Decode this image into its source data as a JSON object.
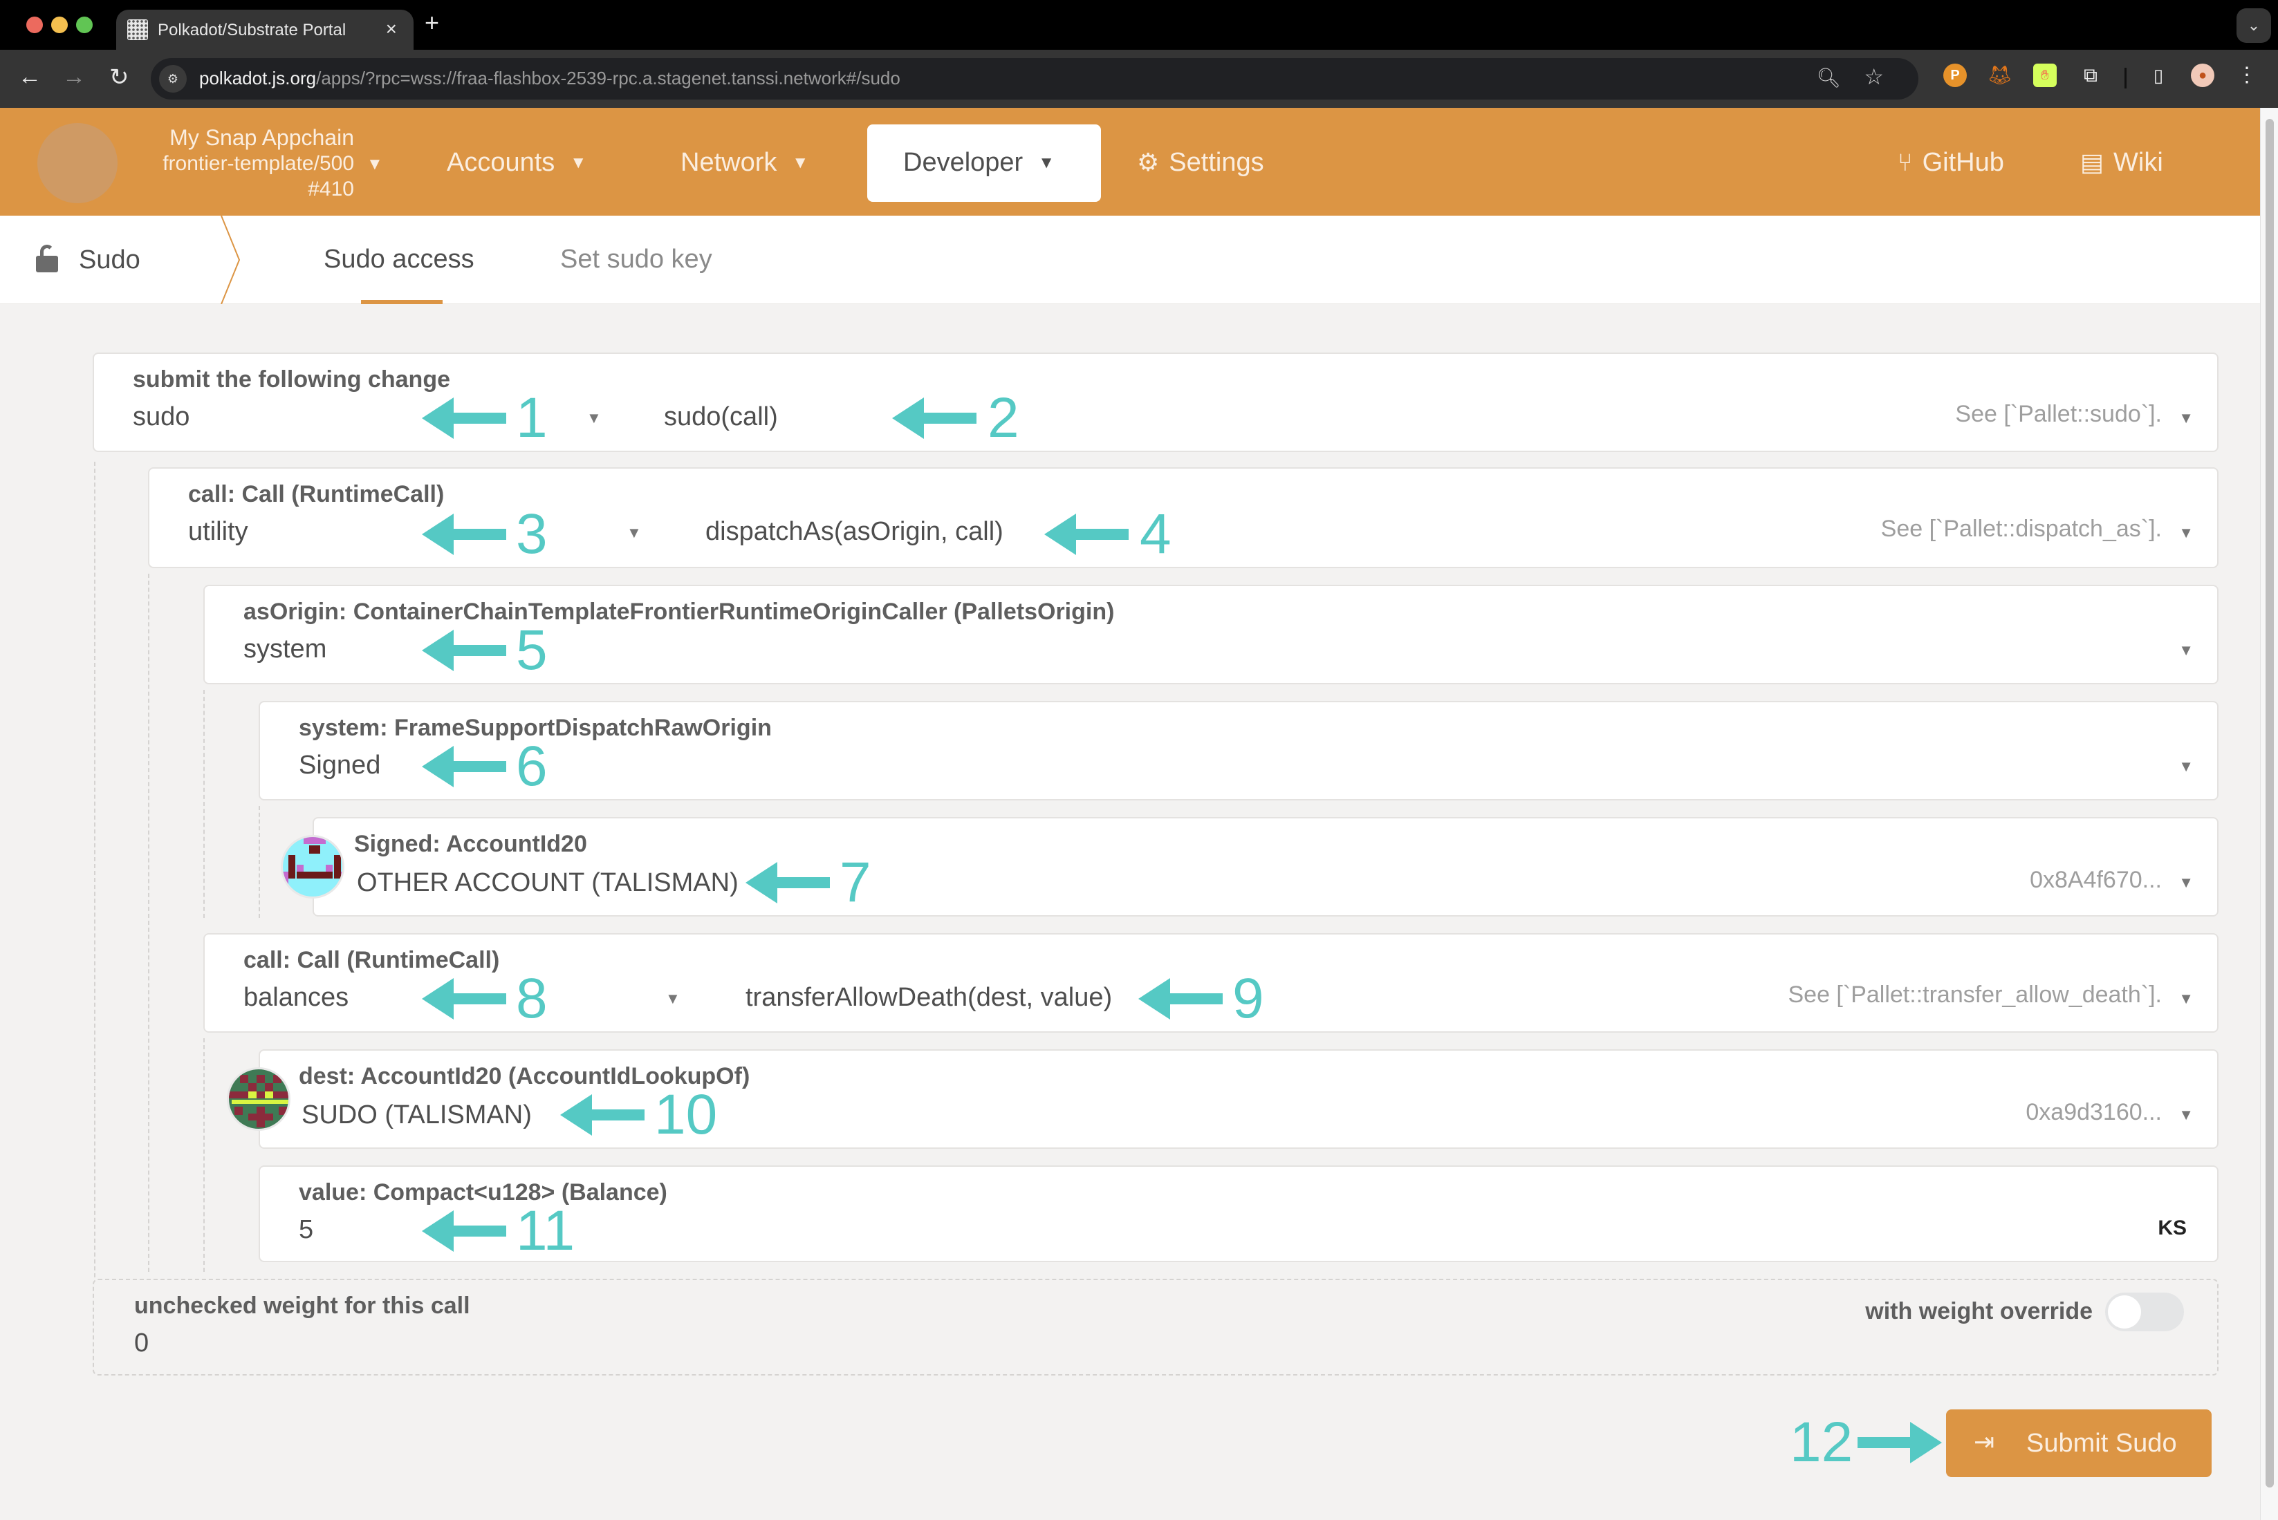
{
  "browser": {
    "tab_title": "Polkadot/Substrate Portal",
    "tab_close": "×",
    "new_tab": "+",
    "tab_dropdown": "⌄",
    "url_host": "polkadot.js.org",
    "url_path": "/apps/?rpc=wss://fraa-flashbox-2539-rpc.a.stagenet.tanssi.network#/sudo",
    "icons": {
      "back": "←",
      "forward": "→",
      "reload": "↻",
      "site_info": "⚙",
      "zoom": "🔍︎",
      "bookmark": "☆",
      "polkadot_ext": "P",
      "metamask_ext": "🦊︎",
      "talisman_ext": "✋︎",
      "extensions": "⧉",
      "side_panel": "▯",
      "profile": "●",
      "menu": "⋮"
    }
  },
  "header": {
    "chain_name": "My Snap Appchain",
    "chain_runtime": "frontier-template/500",
    "chain_block": "#410",
    "caret": "▼",
    "menu": {
      "accounts": "Accounts",
      "network": "Network",
      "developer": "Developer",
      "settings": "Settings",
      "github": "GitHub",
      "wiki": "Wiki"
    },
    "icons": {
      "settings": "⚙",
      "github": "⑂",
      "wiki": "▤"
    }
  },
  "subnav": {
    "section": "Sudo",
    "tabs": [
      {
        "label": "Sudo access",
        "active": true
      },
      {
        "label": "Set sudo key",
        "active": false
      }
    ]
  },
  "form": {
    "submit_change": {
      "label": "submit the following change",
      "pallet": "sudo",
      "method": "sudo(call)",
      "hint": "See [`Pallet::sudo`]."
    },
    "call1": {
      "label": "call: Call (RuntimeCall)",
      "pallet": "utility",
      "method": "dispatchAs(asOrigin, call)",
      "hint": "See [`Pallet::dispatch_as`]."
    },
    "as_origin": {
      "label": "asOrigin: ContainerChainTemplateFrontierRuntimeOriginCaller (PalletsOrigin)",
      "value": "system"
    },
    "system": {
      "label": "system: FrameSupportDispatchRawOrigin",
      "value": "Signed"
    },
    "signed": {
      "label": "Signed: AccountId20",
      "account_name": "OTHER ACCOUNT (TALISMAN)",
      "address": "0x8A4f670..."
    },
    "call2": {
      "label": "call: Call (RuntimeCall)",
      "pallet": "balances",
      "method": "transferAllowDeath(dest, value)",
      "hint": "See [`Pallet::transfer_allow_death`]."
    },
    "dest": {
      "label": "dest: AccountId20 (AccountIdLookupOf)",
      "account_name": "SUDO (TALISMAN)",
      "address": "0xa9d3160..."
    },
    "value": {
      "label": "value: Compact<u128> (Balance)",
      "amount": "5",
      "unit": "KS"
    },
    "weight": {
      "label": "unchecked weight for this call",
      "value": "0",
      "override_label": "with weight override",
      "override_enabled": false
    },
    "caret": "▼",
    "submit_label": "Submit Sudo",
    "submit_icon": "⇥"
  },
  "annotations": [
    "1",
    "2",
    "3",
    "4",
    "5",
    "6",
    "7",
    "8",
    "9",
    "10",
    "11",
    "12"
  ],
  "colors": {
    "brand": "#dc9544",
    "annotation": "#55c9c4",
    "page_bg": "#f3f2f1"
  }
}
